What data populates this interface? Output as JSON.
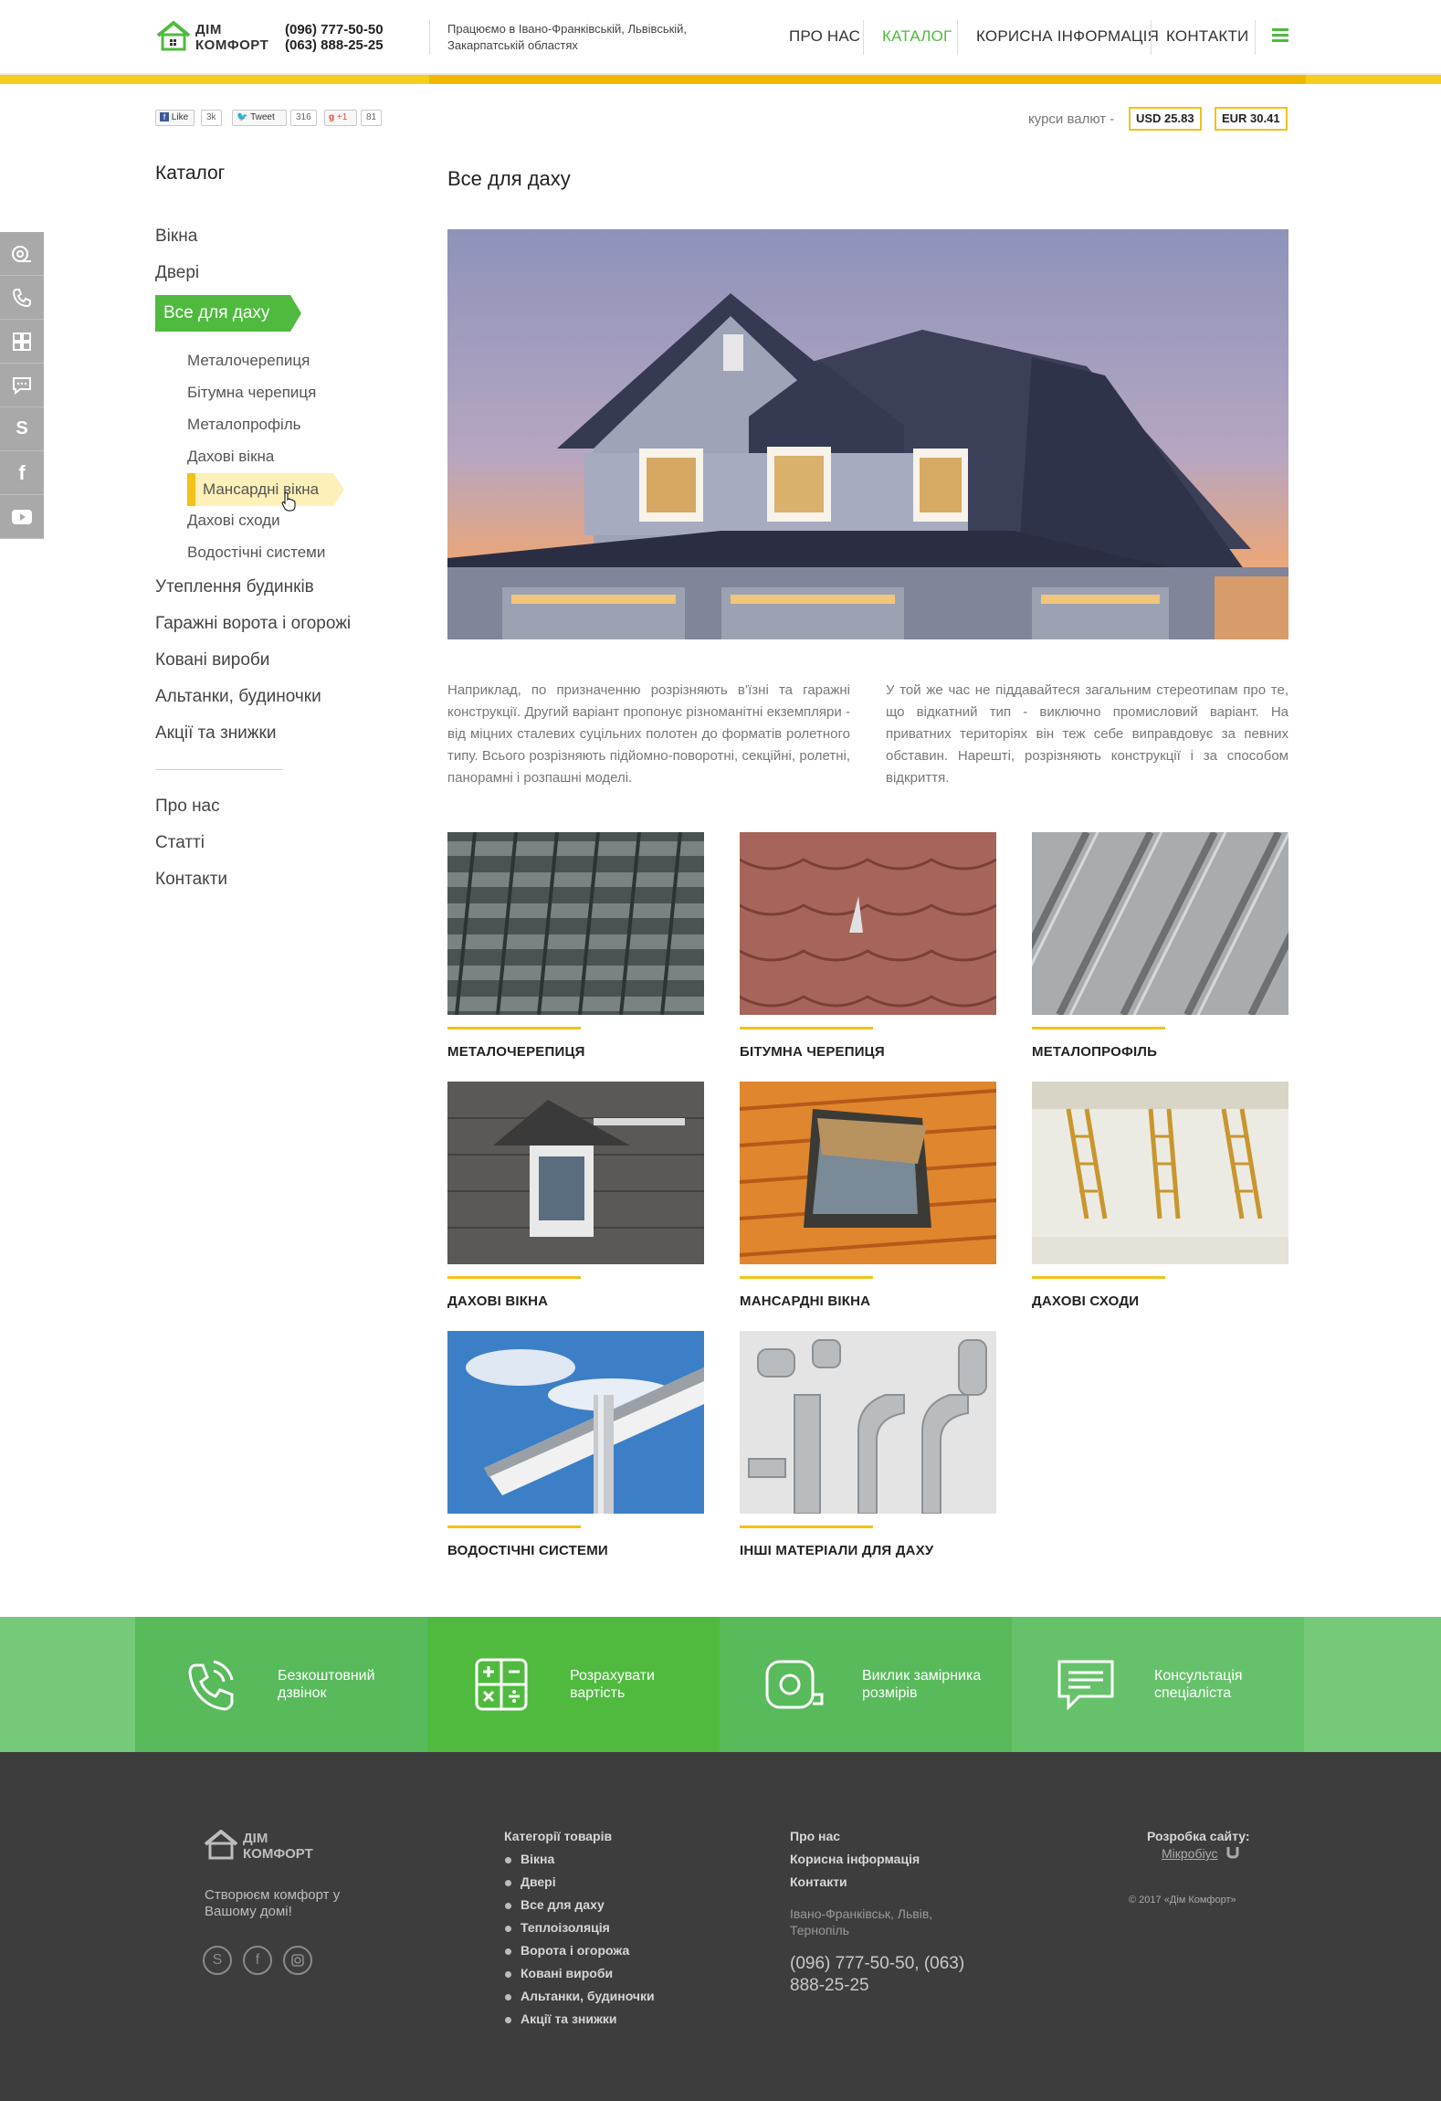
{
  "header": {
    "logo_line1": "ДІМ",
    "logo_line2": "КОМФОРТ",
    "phone1": "(096) 777-50-50",
    "phone2": "(063) 888-25-25",
    "regions": "Працюємо в Івано-Франківській, Львівській, Закарпатській областях",
    "nav": [
      {
        "label": "Про нас"
      },
      {
        "label": "Каталог"
      },
      {
        "label": "Корисна інформація"
      },
      {
        "label": "Контакти"
      }
    ],
    "accent": "#4fba3e",
    "stripe": "#f5cd1c"
  },
  "share": {
    "like": "Like",
    "like_count": "3k",
    "tweet": "Tweet",
    "tweet_count": "316",
    "gplus": "+1",
    "gplus_count": "81"
  },
  "rates": {
    "label": "курси валют -",
    "usd": "USD 25.83",
    "eur": "EUR 30.41"
  },
  "sidebar_icons": [
    "tape-measure-icon",
    "phone-icon",
    "calculator-icon",
    "chat-icon",
    "skype-icon",
    "facebook-icon",
    "youtube-icon"
  ],
  "catalog": {
    "title": "Каталог",
    "items_top": [
      "Вікна",
      "Двері"
    ],
    "active": "Все для даху",
    "subitems": [
      "Металочерепиця",
      "Бітумна черепиця",
      "Металопрофіль",
      "Дахові вікна",
      "Мансардні вікна",
      "Дахові сходи",
      "Водостічні системи"
    ],
    "active_sub_index": 4,
    "items_bottom": [
      "Утеплення будинків",
      "Гаражні ворота і огорожі",
      "Ковані вироби",
      "Альтанки, будиночки",
      "Акції та знижки"
    ],
    "extra": [
      "Про нас",
      "Статті",
      "Контакти"
    ]
  },
  "main": {
    "title": "Все для даху",
    "text_left": "Наприклад, по призначенню розрізняють в’їзні та гаражні конструкції. Другий варіант пропонує різноманітні екземпляри - від міцних сталевих суцільних полотен до форматів ролетного типу. Всього розрізняють підйомно-поворотні, секційні, ролетні, панорамні і розпашні моделі.",
    "text_right": "У той же час не піддавайтеся загальним стереотипам про те, що відкатний тип - виключно промисловий варіант. На приватних територіях він теж себе виправдовує за певних обставин. Нарешті, розрізняють конструкції і за способом відкриття.",
    "tiles": [
      {
        "label": "Металочерепиця"
      },
      {
        "label": "Бітумна черепиця"
      },
      {
        "label": "Металопрофіль"
      },
      {
        "label": "Дахові вікна"
      },
      {
        "label": "Мансардні вікна"
      },
      {
        "label": "Дахові сходи"
      },
      {
        "label": "Водостічні системи"
      },
      {
        "label": "Інші матеріали для даху"
      }
    ]
  },
  "actions": [
    {
      "label": "Безкоштовний дзвінок",
      "icon": "phone-call-icon"
    },
    {
      "label": "Розрахувати вартість",
      "icon": "calculator-icon"
    },
    {
      "label": "Виклик замірника розмірів",
      "icon": "tape-measure-icon"
    },
    {
      "label": "Консультація спеціаліста",
      "icon": "chat-icon"
    }
  ],
  "footer": {
    "logo_line1": "ДІМ",
    "logo_line2": "КОМФОРТ",
    "slogan": "Створюєм комфорт у Вашому домі!",
    "categories_title": "Категорії товарів",
    "categories": [
      "Вікна",
      "Двері",
      "Все для даху",
      "Теплоізоляція",
      "Ворота і огорожа",
      "Ковані вироби",
      "Альтанки, будиночки",
      "Акції та знижки"
    ],
    "links": [
      "Про нас",
      "Корисна інформація",
      "Контакти"
    ],
    "address": "Івано-Франківськ, Львів, Тернопіль",
    "phones": "(096) 777-50-50, (063) 888-25-25",
    "dev_title": "Розробка сайту:",
    "dev_name": "Мікробіус",
    "copyright": "© 2017 «Дім Комфорт»"
  }
}
